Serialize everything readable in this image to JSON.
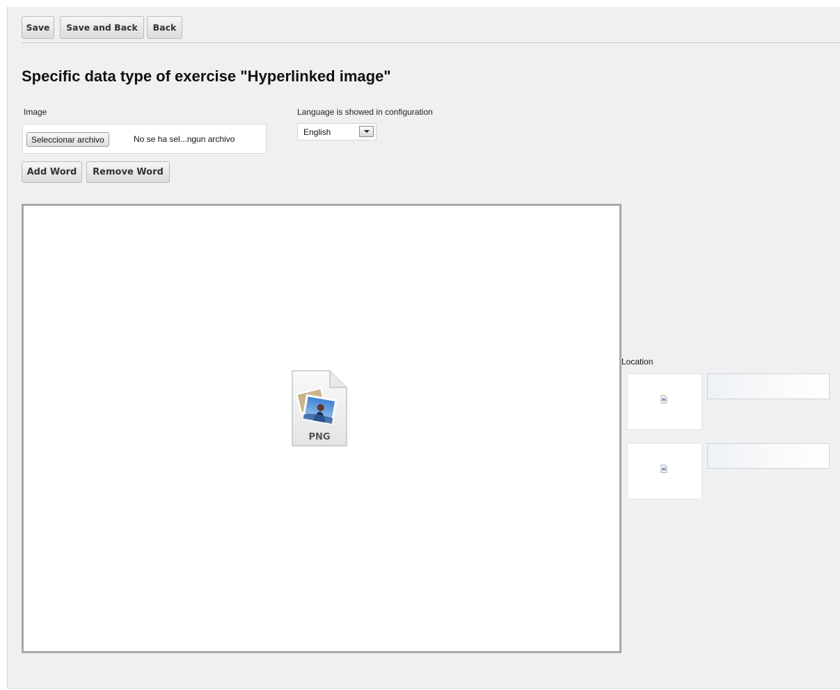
{
  "toolbar": {
    "save_label": "Save",
    "save_and_back_label": "Save and Back",
    "back_label": "Back"
  },
  "page_title": "Specific data type of exercise \"Hyperlinked image\"",
  "image_field": {
    "label": "Image",
    "file_button_label": "Seleccionar archivo",
    "file_status": "No se ha sel...ngun archivo"
  },
  "language_field": {
    "label": "Language is showed in configuration",
    "selected": "English"
  },
  "word_actions": {
    "add_label": "Add Word",
    "remove_label": "Remove Word"
  },
  "canvas": {
    "placeholder_icon": "png-file-icon",
    "file_type": "PNG"
  },
  "location": {
    "label": "Location",
    "entries": [
      {
        "thumbnail_icon": "broken-image-icon",
        "value": ""
      },
      {
        "thumbnail_icon": "broken-image-icon",
        "value": ""
      }
    ]
  },
  "colors": {
    "page_background": "#eff0f1",
    "canvas_border": "#a7a7a7",
    "button_text": "#333333"
  }
}
